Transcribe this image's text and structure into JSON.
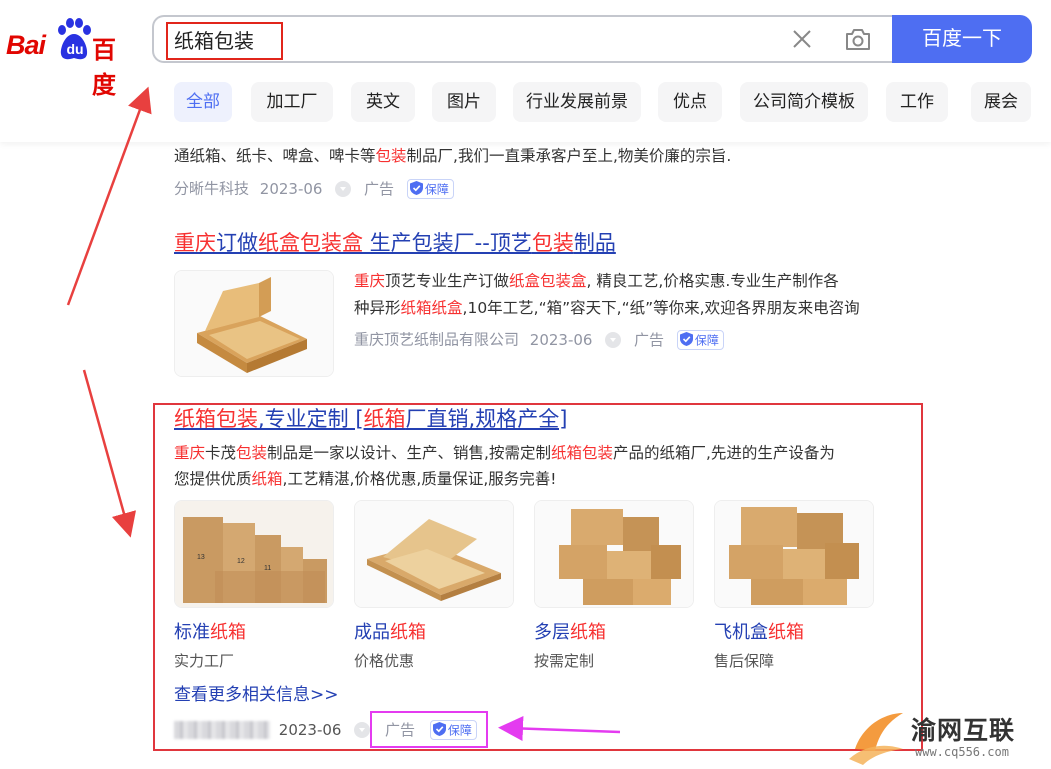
{
  "logo": {
    "brand_latin": "Bai",
    "brand_du": "du",
    "brand_cn": "百度"
  },
  "search": {
    "query": "纸箱包装",
    "button_label": "百度一下"
  },
  "tabs": [
    "全部",
    "加工厂",
    "英文",
    "图片",
    "行业发展前景",
    "优点",
    "公司简介模板",
    "工作",
    "展会"
  ],
  "result1": {
    "desc": {
      "a": "通纸箱、纸卡、啤盒、啤卡等",
      "em": "包装",
      "b": "制品厂,我们一直秉承客户至上,物美价廉的宗旨."
    },
    "source": "分晰牛科技",
    "date": "2023-06",
    "ad_label": "广告",
    "guard_label": "保障"
  },
  "result2": {
    "title": {
      "p1": "重庆",
      "p2": "订做",
      "p3": "纸盒包装盒",
      "p4": " 生产包装厂--顶艺",
      "p5": "包装",
      "p6": "制品"
    },
    "desc1": {
      "a": "重庆",
      "b": "顶艺专业生产订做",
      "c": "纸盒包装盒",
      "d": ", 精良工艺,价格实惠.专业生产制作各"
    },
    "desc2": {
      "a": "种异形",
      "b": "纸箱纸盒",
      "c": ",10年工艺,“箱”容天下,“纸”等你来,欢迎各界朋友来电咨询"
    },
    "source": "重庆顶艺纸制品有限公司",
    "date": "2023-06",
    "ad_label": "广告",
    "guard_label": "保障"
  },
  "result3": {
    "title": {
      "p1": "纸箱包装",
      "p2": ",专业定制 [",
      "p3": "纸箱",
      "p4": "厂直销,规格产全]"
    },
    "desc1": {
      "a": "重庆",
      "b": "卡茂",
      "c": "包装",
      "d": "制品是一家以设计、生产、销售,按需定制",
      "e": "纸箱包装",
      "f": "产品的纸箱厂,先进的生产设备为"
    },
    "desc2": {
      "a": "您提供优质",
      "b": "纸箱",
      "c": ",工艺精湛,价格优惠,质量保证,服务完善!"
    },
    "gallery": [
      {
        "t1": "标准",
        "t2": "纸箱",
        "sub": "实力工厂"
      },
      {
        "t1": "成品",
        "t2": "纸箱",
        "sub": "价格优惠"
      },
      {
        "t1": "多层",
        "t2": "纸箱",
        "sub": "按需定制"
      },
      {
        "t1": "飞机盒",
        "t2": "纸箱",
        "sub": "售后保障"
      }
    ],
    "box_numbers": [
      "13",
      "12",
      "11"
    ],
    "more": "查看更多相关信息>>",
    "date": "2023-06",
    "ad_label": "广告",
    "guard_label": "保障"
  },
  "watermark": {
    "name": "渝网互联",
    "url": "www.cq556.com"
  },
  "colors": {
    "accent": "#4e6ef2",
    "highlight": "#f73131",
    "link": "#2440b3",
    "annotation_red": "#e0363d",
    "annotation_magenta": "#e43bf0"
  }
}
